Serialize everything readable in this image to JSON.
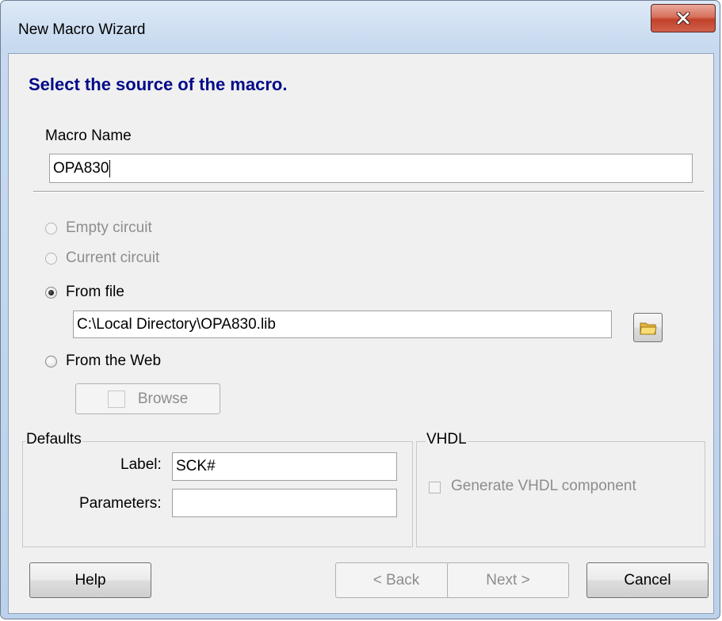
{
  "window": {
    "title": "New Macro Wizard"
  },
  "heading": "Select the source of the macro.",
  "macro_name": {
    "label": "Macro Name",
    "value": "OPA830"
  },
  "source": {
    "options": [
      {
        "label": "Empty circuit",
        "enabled": false,
        "selected": false
      },
      {
        "label": "Current circuit",
        "enabled": false,
        "selected": false
      },
      {
        "label": "From file",
        "enabled": true,
        "selected": true
      },
      {
        "label": "From the Web",
        "enabled": true,
        "selected": false
      }
    ],
    "file_path": "C:\\Local Directory\\OPA830.lib",
    "browse_label": "Browse"
  },
  "defaults": {
    "title": "Defaults",
    "label_label": "Label:",
    "label_value": "SCK#",
    "parameters_label": "Parameters:",
    "parameters_value": ""
  },
  "vhdl": {
    "title": "VHDL",
    "generate_label": "Generate VHDL component",
    "generate_checked": false
  },
  "buttons": {
    "help": "Help",
    "back": "< Back",
    "next": "Next >",
    "cancel": "Cancel"
  },
  "icons": {
    "close": "close-icon",
    "folder": "folder-icon"
  }
}
